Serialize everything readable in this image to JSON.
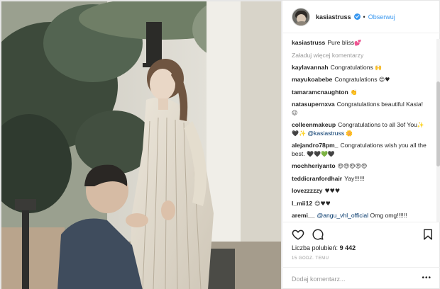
{
  "header": {
    "username": "kasiastruss",
    "follow_label": "Obserwuj",
    "separator": "•"
  },
  "caption": {
    "username": "kasiastruss",
    "text": "Pure bliss",
    "emoji": "💕"
  },
  "load_more": "Załaduj więcej komentarzy",
  "comments": [
    {
      "username": "kaylavannah",
      "text": "Congratulations ",
      "emoji": "🙌"
    },
    {
      "username": "mayukoabebe",
      "text": "Congratulations ",
      "emoji": "😍♥"
    },
    {
      "username": "tamaramcnaughton",
      "text": "",
      "emoji": "👏"
    },
    {
      "username": "natasupernxva",
      "text": "Congratulations beautiful Kasia! ",
      "emoji": "☺"
    },
    {
      "username": "colleenmakeup",
      "text": "Congratulations to all 3of You",
      "emoji": "✨🖤✨",
      "mention": "@kasiastruss",
      "tail": "🌼"
    },
    {
      "username": "alejandro78pm_",
      "text": "Congratulations wish you all the best. ",
      "emoji": "🖤🖤💚🖤"
    },
    {
      "username": "mochheriyanto",
      "text": "",
      "emoji": "😍😍😍😍😍"
    },
    {
      "username": "teddicranfordhair",
      "text": "Yay!!!!!!",
      "emoji": ""
    },
    {
      "username": "lovezzzzzy",
      "text": "",
      "emoji": "♥♥♥"
    },
    {
      "username": "l_mii12",
      "text": "",
      "emoji": "😍♥♥"
    },
    {
      "username": "aremi__",
      "text": " Omg omg!!!!!!",
      "emoji": "",
      "mention_first": "@angu_vhl_official"
    }
  ],
  "icons": [
    "heart-icon",
    "comment-icon",
    "bookmark-icon",
    "verified-icon",
    "more-options-icon"
  ],
  "likes": {
    "label": "Liczba polubień:",
    "count": "9 442"
  },
  "time": "15 GODZ. TEMU",
  "add_comment": {
    "placeholder": "Dodaj komentarz...",
    "value": ""
  },
  "more_label": "•••",
  "colors": {
    "link": "#3897f0",
    "text": "#262626",
    "muted": "#999999",
    "border": "#efefef"
  }
}
